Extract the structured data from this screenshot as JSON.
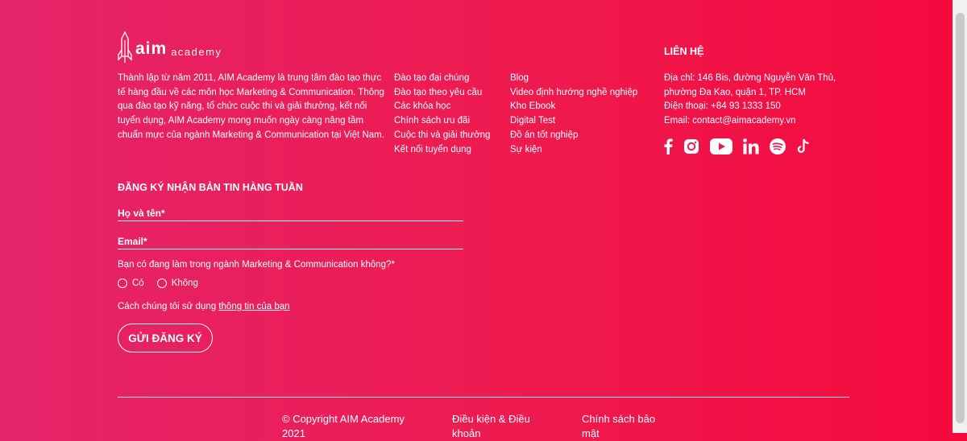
{
  "brand": {
    "logo_primary": "aim",
    "logo_secondary": "academy"
  },
  "about": {
    "text": "Thành lập từ năm 2011, AIM Academy là trung tâm đào tạo thực tế hàng đầu về các môn học Marketing & Communication. Thông qua đào tạo kỹ năng, tổ chức cuộc thi và giải thưởng, kết nối tuyển dụng, AIM Academy mong muốn ngày càng nâng tầm chuẩn mực của ngành Marketing & Communication tại Việt Nam."
  },
  "links_col1": [
    "Đào tạo đại chúng",
    "Đào tạo theo yêu cầu",
    "Các khóa học",
    "Chính sách ưu đãi",
    "Cuộc thi và giải thưởng",
    "Kết nối tuyển dụng"
  ],
  "links_col2": [
    "Blog",
    "Video định hướng nghề nghiệp",
    "Kho Ebook",
    "Digital Test",
    "Đồ án tốt nghiệp",
    "Sự kiện"
  ],
  "contact": {
    "title": "LIÊN HỆ",
    "address": "Địa chỉ: 146 Bis, đường Nguyễn Văn Thủ, phường Đa Kao, quận 1, TP. HCM",
    "phone": "Điện thoại: +84 93 1333 150",
    "email": "Email: contact@aimacademy.vn"
  },
  "social": [
    "facebook-icon",
    "instagram-icon",
    "youtube-icon",
    "linkedin-icon",
    "spotify-icon",
    "tiktok-icon"
  ],
  "newsletter": {
    "title": "ĐĂNG KÝ NHẬN BẢN TIN HÀNG TUẦN",
    "name_placeholder": "Họ và tên*",
    "email_placeholder": "Email*",
    "question": "Bạn có đang làm trong ngành Marketing & Communication không?*",
    "option_yes": "Có",
    "option_no": "Không",
    "privacy_prefix": "Cách chúng tôi sử dụng ",
    "privacy_link": "thông tin của bạn",
    "submit": "GỬI ĐĂNG KÝ"
  },
  "bottom": {
    "copyright": "© Copyright AIM Academy 2021",
    "terms": "Điều kiện & Điều khoản",
    "policy": "Chính sách bảo mật"
  },
  "colors": {
    "gradient_start": "#e5246a",
    "gradient_end": "#f5093d",
    "text": "#ffffff"
  }
}
